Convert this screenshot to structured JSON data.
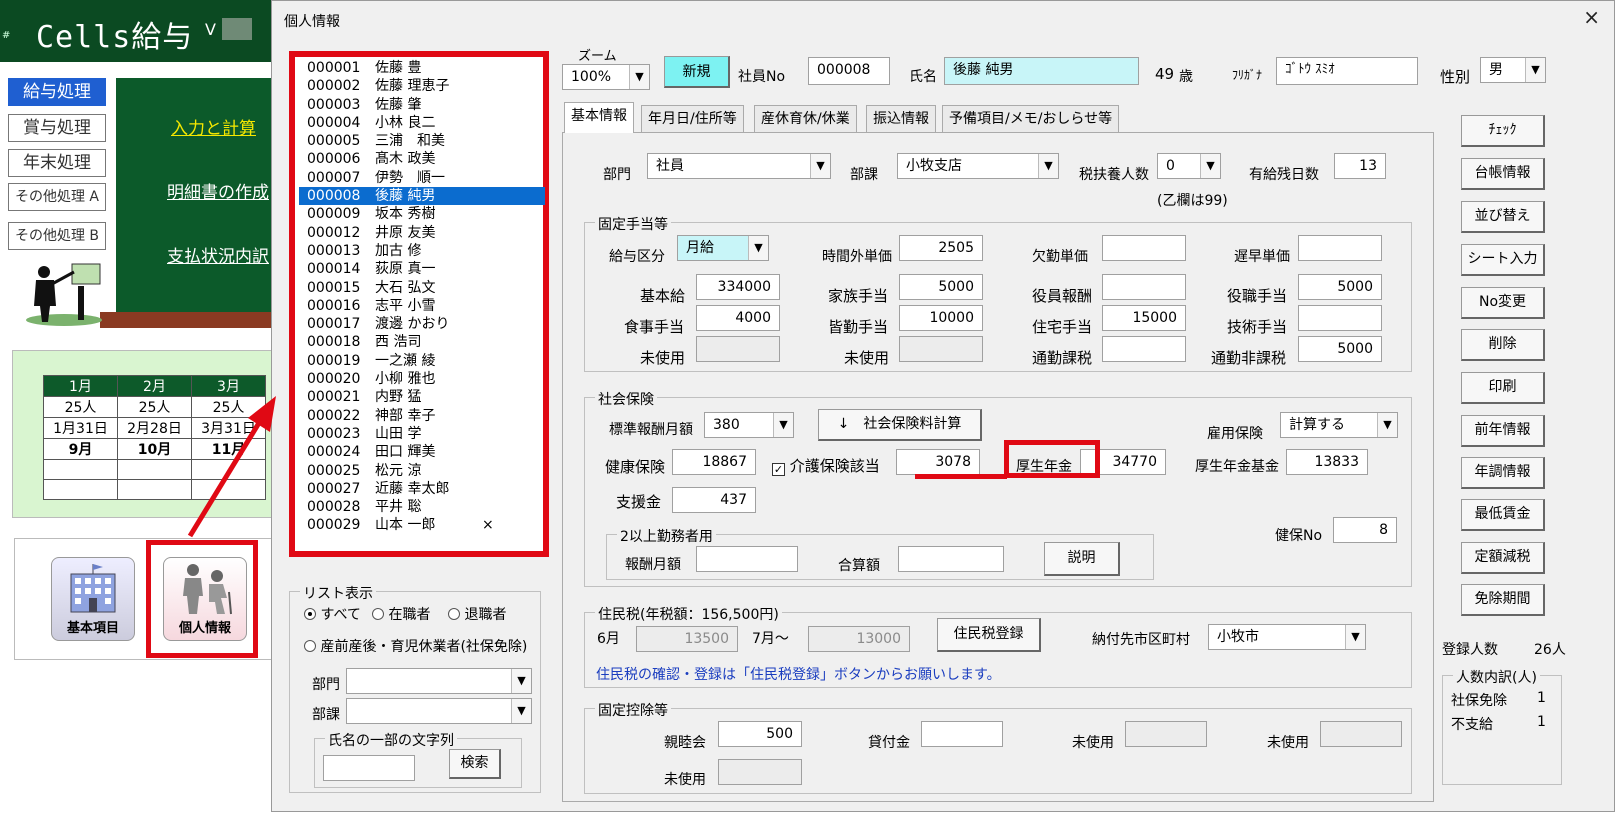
{
  "background_app": {
    "title": "Cells給与",
    "version_label": "V",
    "menu": [
      "給与処理",
      "賞与処理",
      "年末処理",
      "その他処理 A",
      "その他処理 B"
    ],
    "board_links": [
      "入力と計算",
      "明細書の作成",
      "支払状況内訳"
    ],
    "calendar": {
      "months": [
        "1月",
        "2月",
        "3月"
      ],
      "counts": [
        "25人",
        "25人",
        "25人"
      ],
      "dates": [
        "1月31日",
        "2月28日",
        "3月31日"
      ],
      "next_months": [
        "9月",
        "10月",
        "11月"
      ]
    },
    "tiles": [
      "基本項目",
      "個人情報"
    ]
  },
  "dialog": {
    "title": "個人情報",
    "close": "×",
    "zoom_label": "ズーム",
    "zoom_value": "100%",
    "new_button": "新規",
    "employee_no_label": "社員No",
    "employee_no": "000008",
    "name_label": "氏名",
    "name": "後藤 純男",
    "age": "49",
    "age_unit": "歳",
    "furigana_label": "ﾌﾘｶﾞﾅ",
    "furigana": "ｺﾞﾄｳ ｽﾐｵ",
    "gender_label": "性別",
    "gender": "男",
    "employees": [
      {
        "no": "000001",
        "name": "佐藤 豊"
      },
      {
        "no": "000002",
        "name": "佐藤 理恵子"
      },
      {
        "no": "000003",
        "name": "佐藤 肇"
      },
      {
        "no": "000004",
        "name": "小林 良二"
      },
      {
        "no": "000005",
        "name": "三浦　和美"
      },
      {
        "no": "000006",
        "name": "髙木 政美"
      },
      {
        "no": "000007",
        "name": "伊勢　順一"
      },
      {
        "no": "000008",
        "name": "後藤 純男"
      },
      {
        "no": "000009",
        "name": "坂本 秀樹"
      },
      {
        "no": "000012",
        "name": "井原 友美"
      },
      {
        "no": "000013",
        "name": "加古 修"
      },
      {
        "no": "000014",
        "name": "荻原 真一"
      },
      {
        "no": "000015",
        "name": "大石 弘文"
      },
      {
        "no": "000016",
        "name": "志平 小雪"
      },
      {
        "no": "000017",
        "name": "渡邊 かおり"
      },
      {
        "no": "000018",
        "name": "西 浩司"
      },
      {
        "no": "000019",
        "name": "一之瀬 綾"
      },
      {
        "no": "000020",
        "name": "小柳 雅也"
      },
      {
        "no": "000021",
        "name": "内野 猛"
      },
      {
        "no": "000022",
        "name": "神部 幸子"
      },
      {
        "no": "000023",
        "name": "山田 学"
      },
      {
        "no": "000024",
        "name": "田口 輝美"
      },
      {
        "no": "000025",
        "name": "松元 涼"
      },
      {
        "no": "000027",
        "name": "近藤 幸太郎"
      },
      {
        "no": "000028",
        "name": "平井 聡"
      },
      {
        "no": "000029",
        "name": "山本 一郎",
        "mark": "×"
      }
    ],
    "selected_employee": "000008",
    "list_display": {
      "title": "リスト表示",
      "options": [
        "すべて",
        "在職者",
        "退職者"
      ],
      "option_leave": "産前産後・育児休業者(社保免除)",
      "selected": "すべて",
      "dept_label": "部門",
      "section_label": "部課",
      "search_group": "氏名の一部の文字列",
      "search_button": "検索"
    },
    "tabs": [
      "基本情報",
      "年月日/住所等",
      "産休育休/休業",
      "振込情報",
      "予備項目/メモ/おしらせ等"
    ],
    "active_tab": "基本情報",
    "basic": {
      "dept_label": "部門",
      "dept": "社員",
      "section_label": "部課",
      "section": "小牧支店",
      "dependents_label": "税扶養人数",
      "dependents": "0",
      "dependents_note": "(乙欄は99)",
      "paid_leave_label": "有給残日数",
      "paid_leave": "13"
    },
    "fixed_allowance": {
      "title": "固定手当等",
      "pay_type_label": "給与区分",
      "pay_type": "月給",
      "overtime_rate_label": "時間外単価",
      "overtime_rate": "2505",
      "absence_rate_label": "欠勤単価",
      "absence_rate": "",
      "late_rate_label": "遅早単価",
      "late_rate": "",
      "base_pay_label": "基本給",
      "base_pay": "334000",
      "family_label": "家族手当",
      "family": "5000",
      "officer_label": "役員報酬",
      "officer": "",
      "position_label": "役職手当",
      "position": "5000",
      "meal_label": "食事手当",
      "meal": "4000",
      "attendance_label": "皆勤手当",
      "attendance": "10000",
      "housing_label": "住宅手当",
      "housing": "15000",
      "technical_label": "技術手当",
      "technical": "",
      "unused_label": "未使用",
      "commute_tax_label": "通勤課税",
      "commute_tax": "",
      "commute_nontax_label": "通勤非課税",
      "commute_nontax": "5000"
    },
    "social_insurance": {
      "title": "社会保険",
      "std_monthly_label": "標準報酬月額",
      "std_monthly": "380",
      "calc_button": "↓　社会保険料計算",
      "employment_label": "雇用保険",
      "employment": "計算する",
      "health_label": "健康保険",
      "health": "18867",
      "care_label": "介護保険該当",
      "care": "3078",
      "care_checked": "✓",
      "pension_label": "厚生年金",
      "pension": "34770",
      "pension_fund_label": "厚生年金基金",
      "pension_fund": "13833",
      "support_label": "支援金",
      "support": "437",
      "multi_title": "2以上勤務者用",
      "remuneration_label": "報酬月額",
      "remuneration": "",
      "total_label": "合算額",
      "total": "",
      "explain_button": "説明",
      "kenpo_no_label": "健保No",
      "kenpo_no": "8"
    },
    "resident_tax": {
      "title": "住民税(年税額：156,500円)",
      "june_label": "6月",
      "june": "13500",
      "july_label": "7月～",
      "july": "13000",
      "register_button": "住民税登録",
      "city_label": "納付先市区町村",
      "city": "小牧市",
      "note": "住民税の確認・登録は「住民税登録」ボタンからお願いします。"
    },
    "fixed_deduction": {
      "title": "固定控除等",
      "social_club_label": "親睦会",
      "social_club": "500",
      "loan_label": "貸付金",
      "loan": "",
      "unused_label": "未使用"
    },
    "side_buttons": [
      "ﾁｪｯｸ",
      "台帳情報",
      "並び替え",
      "シート入力",
      "No変更",
      "削除",
      "印刷",
      "前年情報",
      "年調情報",
      "最低賃金",
      "定額減税",
      "免除期間"
    ],
    "registered_label": "登録人数",
    "registered": "26人",
    "breakdown": {
      "title": "人数内訳(人)",
      "exempt_label": "社保免除",
      "exempt": "1",
      "unpaid_label": "不支給",
      "unpaid": "1"
    }
  }
}
